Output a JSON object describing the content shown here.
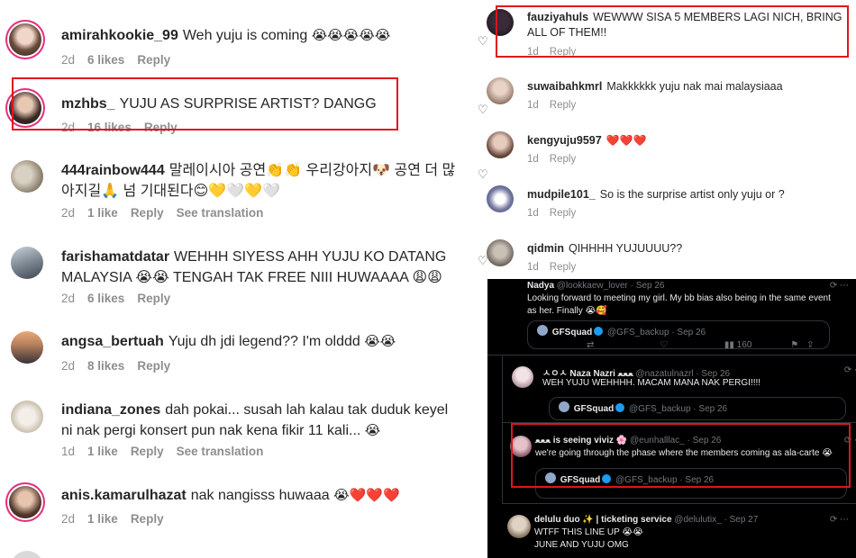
{
  "left_comments": [
    {
      "user": "amirahkookie_99",
      "text": "Weh yuju is coming",
      "emoji": "😭😭😭😭😭",
      "time": "2d",
      "likes": "6 likes",
      "reply": "Reply",
      "translate": ""
    },
    {
      "user": "mzhbs_",
      "text": "YUJU AS SURPRISE ARTIST? DANGG",
      "emoji": "",
      "time": "2d",
      "likes": "16 likes",
      "reply": "Reply",
      "translate": ""
    },
    {
      "user": "444rainbow444",
      "text": "말레이시아 공연👏👏 우리강아지🐶 공연 더 많아지길🙏 넘 기대된다😊💛🤍💛🤍",
      "emoji": "",
      "time": "2d",
      "likes": "1 like",
      "reply": "Reply",
      "translate": "See translation"
    },
    {
      "user": "farishamatdatar",
      "text": "WEHHH SIYESS AHH YUJU KO DATANG MALAYSIA 😭😭 TENGAH TAK FREE NIII HUWAAAA 😩😩",
      "emoji": "",
      "time": "2d",
      "likes": "6 likes",
      "reply": "Reply",
      "translate": ""
    },
    {
      "user": "angsa_bertuah",
      "text": "Yuju dh jdi legend?? I'm olddd",
      "emoji": "😭😭",
      "time": "2d",
      "likes": "8 likes",
      "reply": "Reply",
      "translate": ""
    },
    {
      "user": "indiana_zones",
      "text": "dah pokai... susah lah kalau tak duduk keyel ni nak pergi konsert pun nak kena fikir 11 kali...",
      "emoji": "😭",
      "time": "1d",
      "likes": "1 like",
      "reply": "Reply",
      "translate": "See translation"
    },
    {
      "user": "anis.kamarulhazat",
      "text": "nak nangisss huwaaa",
      "emoji": "😭❤️❤️❤️",
      "time": "2d",
      "likes": "1 like",
      "reply": "Reply",
      "translate": ""
    }
  ],
  "right_comments": [
    {
      "user": "fauziyahuls",
      "text": "WEWWW SISA 5 MEMBERS LAGI NICH, BRING ALL OF THEM!!",
      "time": "1d",
      "reply": "Reply"
    },
    {
      "user": "suwaibahkmrl",
      "text": "Makkkkkk yuju nak mai malaysiaaa",
      "time": "1d",
      "reply": "Reply"
    },
    {
      "user": "kengyuju9597",
      "text": "❤️❤️❤️",
      "time": "1d",
      "reply": "Reply"
    },
    {
      "user": "mudpile101_",
      "text": "So is the surprise artist only yuju or ?",
      "time": "1d",
      "reply": "Reply"
    },
    {
      "user": "qidmin",
      "text": "QIHHHH YUJUUUU??",
      "time": "1d",
      "reply": "Reply"
    }
  ],
  "tweets": [
    {
      "name": "Nadya",
      "handle": "@lookkaew_lover · Sep 26",
      "text": "Looking forward to meeting my girl. My bb bias also being in the same event as her. Finally 😭🥰",
      "quote_name": "GFSquad",
      "quote_handle": "@GFS_backup · Sep 26",
      "views": "160"
    },
    {
      "name": "ㅅㅇㅅ Naza Nazri ﻌﻌﻌ",
      "handle": "@nazatulnazrl · Sep 26",
      "text": "WEH YUJU WEHHHH. MACAM MANA NAK PERGI!!!!",
      "quote_name": "GFSquad",
      "quote_handle": "@GFS_backup · Sep 26",
      "views": ""
    },
    {
      "name": "ﻌﻌﻌ is seeing viviz 🌸",
      "handle": "@eunhalllac_ · Sep 26",
      "text": "we're going through the phase where the members coming as ala-carte 😭",
      "quote_name": "GFSquad",
      "quote_handle": "@GFS_backup · Sep 26",
      "views": ""
    },
    {
      "name": "delulu duo ✨ | ticketing service",
      "handle": "@delulutix_ · Sep 27",
      "text": "WTFF THIS LINE UP 😭😭\nJUNE AND YUJU OMG",
      "quote_name": "",
      "quote_handle": "",
      "views": ""
    }
  ]
}
